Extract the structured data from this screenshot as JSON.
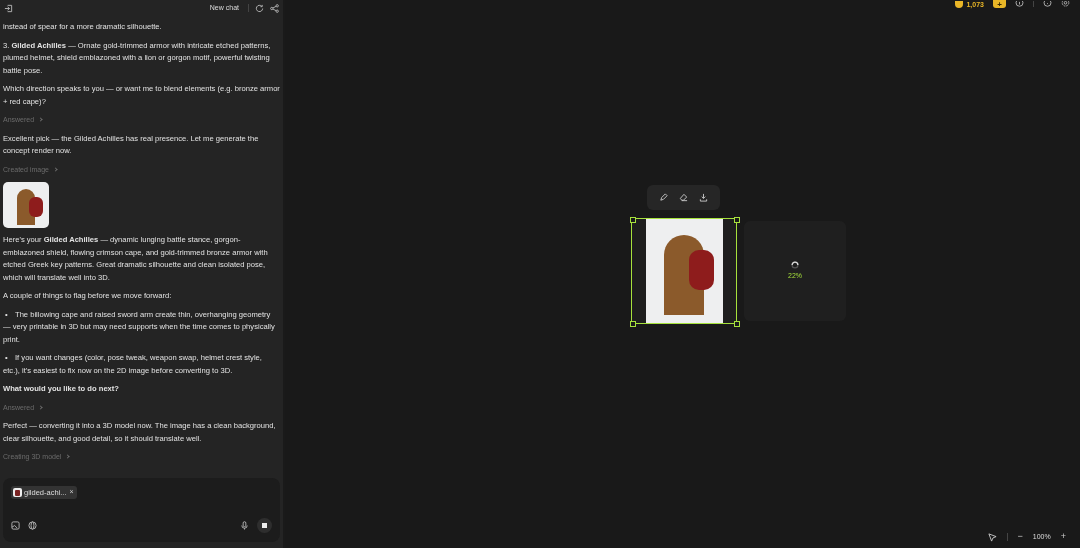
{
  "chat_header": {
    "new_chat": "New chat"
  },
  "messages": [
    {
      "kind": "text",
      "text": "instead of spear for a more dramatic silhouette."
    },
    {
      "kind": "text",
      "text": "3. **Gilded Achilles** — Ornate gold-trimmed armor with intricate etched patterns, plumed helmet, shield emblazoned with a lion or gorgon motif, powerful twisting battle pose."
    },
    {
      "kind": "text",
      "text": "Which direction speaks to you — or want me to blend elements (e.g. bronze armor + red cape)?"
    },
    {
      "kind": "status",
      "text": "Answered"
    },
    {
      "kind": "text",
      "text": "Excellent pick — the Gilded Achilles has real presence. Let me generate the concept render now."
    },
    {
      "kind": "status",
      "text": "Created image"
    },
    {
      "kind": "image"
    },
    {
      "kind": "text",
      "text": "Here's your **Gilded Achilles** — dynamic lunging battle stance, gorgon-emblazoned shield, flowing crimson cape, and gold-trimmed bronze armor with etched Greek key patterns. Great dramatic silhouette and clean isolated pose, which will translate well into 3D."
    },
    {
      "kind": "text",
      "text": "A couple of things to flag before we move forward:"
    },
    {
      "kind": "bullet",
      "marker": "•",
      "text": "The billowing cape and raised sword arm create thin, overhanging geometry — very printable in 3D but may need supports when the time comes to physically print."
    },
    {
      "kind": "bullet",
      "marker": "•",
      "text": "If you want changes (color, pose tweak, weapon swap, helmet crest style, etc.), it's easiest to fix now on the 2D image before converting to 3D."
    },
    {
      "kind": "heading",
      "text": "What would you like to do next?"
    },
    {
      "kind": "status",
      "text": "Answered"
    },
    {
      "kind": "text",
      "text": "Perfect — converting it into a 3D model now. The image has a clean background, clear silhouette, and good detail, so it should translate well."
    },
    {
      "kind": "status",
      "text": "Creating 3D model"
    }
  ],
  "composer": {
    "attachment": "gilded-achi...",
    "remove": "×"
  },
  "top_bar": {
    "credits": "1,073",
    "add": "+"
  },
  "canvas": {
    "generated_image": {
      "selected": true
    },
    "loading_card": {
      "progress": "22%"
    }
  },
  "zoom_bar": {
    "minus": "−",
    "zoom": "100%",
    "plus": "+"
  }
}
